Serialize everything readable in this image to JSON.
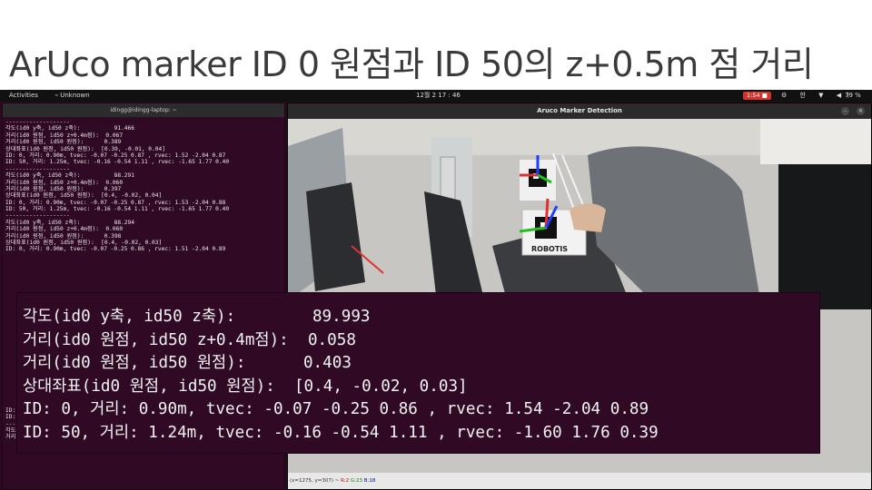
{
  "slide": {
    "title": "ArUco marker ID 0 원점과 ID 50의 z+0.5m 점 거리"
  },
  "topbar": {
    "activities": "Activities",
    "app_name": "Unknown",
    "clock": "12월 2 17 : 46",
    "recording": "1:54",
    "tray": "⚙ 한 ▼ ◀)",
    "battery": "79 %"
  },
  "terminal": {
    "title": "idingg@idingg-laptop: ~",
    "lines": [
      "-------------------",
      "각도(id0 y축, id50 z축):          91.466",
      "거리(id0 원점, id50 z+0.4m점):  0.067",
      "거리(id0 원점, id50 원점):      0.389",
      "상대좌표(id0 원점, id50 원점):  [0.39, -0.01, 0.04]",
      "ID: 0, 거리: 0.90m, tvec: -0.07 -0.25 0.87 , rvec: 1.52 -2.04 0.87",
      "ID: 50, 거리: 1.25m, tvec: -0.16 -0.54 1.11 , rvec: -1.65 1.77 0.40",
      "-------------------",
      "각도(id0 y축, id50 z축):          88.291",
      "거리(id0 원점, id50 z+0.4m점):  0.060",
      "거리(id0 원점, id50 원점):      0.397",
      "상대좌표(id0 원점, id50 원점):  [0.4, -0.02, 0.04]",
      "ID: 0, 거리: 0.90m, tvec: -0.07 -0.25 0.87 , rvec: 1.53 -2.04 0.88",
      "ID: 50, 거리: 1.25m, tvec: -0.16 -0.54 1.11 , rvec: -1.65 1.77 0.40",
      "-------------------",
      "각도(id0 y축, id50 z축):          88.294",
      "거리(id0 원점, id50 z+0.4m점):  0.060",
      "거리(id0 원점, id50 원점):      0.398",
      "상대좌표(id0 원점, id50 원점):  [0.4, -0.02, 0.03]",
      "ID: 0, 거리: 0.90m, tvec: -0.07 -0.25 0.86 , rvec: 1.51 -2.04 0.89",
      "",
      "",
      "",
      "",
      "",
      "",
      "",
      "",
      "",
      "",
      "",
      "",
      "",
      "",
      "",
      "",
      "",
      "",
      "",
      "",
      "",
      "",
      "",
      "ID: 0, 거리: 0.90m, tvec: -0.07 -0.25 0.86 , rvec: 1.54 -2.04 0.89",
      "ID: 50, 거리: 1.25m, tvec: -0.16 -0.54 1.12 , rvec: -1.63 1.76 0.38",
      "-------------------",
      "각도(id0 y축, id50 z축):          89.993",
      "거리(id0 원점, id50 z+0.4m점):  0.058"
    ]
  },
  "camera_window": {
    "title": "Aruco Marker Detection",
    "status_coords": "(x=1275, y=307) ~",
    "status_r": "R:2",
    "status_g": "G:23",
    "status_b": "B:18",
    "marker_label": "ROBOTIS"
  },
  "overlay": {
    "lines": [
      "각도(id0 y축, id50 z축):        89.993",
      "거리(id0 원점, id50 z+0.4m점):  0.058",
      "거리(id0 원점, id50 원점):      0.403",
      "상대좌표(id0 원점, id50 원점):  [0.4, -0.02, 0.03]",
      "ID: 0, 거리: 0.90m, tvec: -0.07 -0.25 0.86 , rvec: 1.54 -2.04 0.89",
      "ID: 50, 거리: 1.24m, tvec: -0.16 -0.54 1.11 , rvec: -1.60 1.76 0.39"
    ]
  },
  "colors": {
    "terminal_bg": "#300a24",
    "axis_x": "#e03030",
    "axis_y": "#20c020",
    "axis_z": "#2040ff",
    "rec_badge": "#d0342c"
  },
  "icons": {
    "app_menu": "terminal-icon",
    "minimize": "minimize-icon",
    "close": "close-icon",
    "record": "record-icon",
    "battery": "battery-icon"
  }
}
